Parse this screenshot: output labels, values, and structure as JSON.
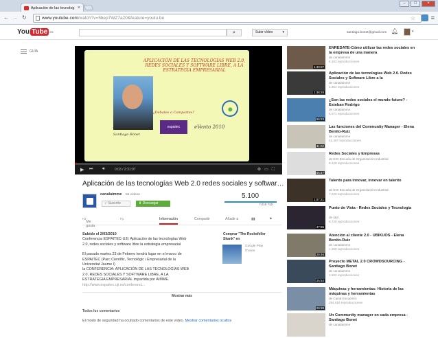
{
  "browser": {
    "tab_title": "Aplicación de las tecnolog",
    "url_main": "www.youtube.com",
    "url_rest": "/watch?v=5bep7WZ7a20&feature=youtu.be"
  },
  "header": {
    "logo_you": "You",
    "logo_tube": "Tube",
    "logo_region": "ES",
    "upload_label": "Subir vídeo",
    "email": "santiago.bonet@gmail.com"
  },
  "guide": {
    "label": "GUÍA"
  },
  "player": {
    "slide_title": "APLICACIÓN DE LAS TECNOLOGÍAS WEB 2.0, REDES SOCIALES Y SOFTWARE LIBRE, A LA ESTRATEGIA EMPRESARIAL",
    "slide_question": "¿Debates o Compartes?",
    "caption": "Santiago Bonet",
    "sponsor": "espaitec",
    "event": "eVento 2010",
    "time": "0:03 / 2:31:07"
  },
  "video": {
    "title": "Aplicación de las tecnologías Web 2.0 redes sociales y softwar…",
    "channel": "canalaimme",
    "channel_videos": "56 vídeos",
    "subscribe": "Suscrito",
    "download": "Descargar",
    "views": "5.100",
    "likes": "16",
    "dislikes": "0"
  },
  "tabs": [
    "Me gusta",
    "Información",
    "Compartir",
    "Añadir a"
  ],
  "description": {
    "uploaded": "Subido el 2/03/2010",
    "lines": [
      "Conferencia ESPAITEC-UJI: Aplicación de las tecnologías Web",
      "2.0, redes sociales y software libre la estrategia empresarial",
      "",
      "El pasado martes 23 de Febrero tendrá lugar en el marco de",
      "ESPAITEC (Parc Científic, Tecnològic i Empresarial de la",
      "Universitat Jaume I)",
      "la CONFERENCIA: APLICACIÓN DE LAS TECNOLOGÍAS WEB",
      "2.0, REDES SOCIALES Y SOFTWARE LIBRE, A LA",
      "ESTRATEGIA EMPRESARIAL impartida por AIMME."
    ],
    "link": "http://www.espaitec.uji.es/conferenci...",
    "buy_label": "Comprar \"The Rockefeller Skank\" en",
    "store": "Google Play",
    "store2": "iTunes",
    "show_more": "Mostrar más"
  },
  "comments": {
    "header": "Todos los comentarios",
    "note": "El modo de seguridad ha ocultado comentarios de este vídeo.",
    "link": "Mostrar comentarios ocultos"
  },
  "related": [
    {
      "title": "ENREDATE-Cómo utilizar las redes sociales en la empresa de una manera",
      "by": "de canalaimme",
      "views": "6.153 reproducciones",
      "dur": "1:40:07",
      "color": "#6d5a4a"
    },
    {
      "title": "Aplicación de las tecnologías Web 2.0. Redes Sociales y Software Libre a la",
      "by": "de canalaimme",
      "views": "2.364 reproducciones",
      "dur": "1:38:28",
      "color": "#3a3a3a"
    },
    {
      "title": "¿Son las redes sociales el mundo futuro? - Esteban Rodrigo",
      "by": "de canalaimme",
      "views": "5.071 reproducciones",
      "dur": "56:23",
      "color": "#4a7fb0"
    },
    {
      "title": "Las funciones del Community Manager - Elena Benito-Ruiz",
      "by": "de canalaimme",
      "views": "41.467 reproducciones",
      "dur": "31:02",
      "color": "#c9c4b8"
    },
    {
      "title": "Redes Sociales y Empresas",
      "by": "de EOI Escuela de Organización Industrial",
      "views": "8.429 reproducciones",
      "dur": "56:47",
      "color": "#ddd"
    },
    {
      "title": "Talento para innovar, innovar en talento",
      "by": "de EOI Escuela de Organización Industrial",
      "views": "7.229 reproducciones",
      "dur": "1:07:21",
      "color": "#3d3228"
    },
    {
      "title": "Punto de Vista - Redes Sociales y Tecnología",
      "by": "de utpl",
      "views": "8.720 reproducciones",
      "dur": "47:55",
      "color": "#2a2530"
    },
    {
      "title": "Atención al cliente 2.0 - UBIKUOS - Elena Benito-Ruiz",
      "by": "de canalaimme",
      "views": "1.260 reproducciones",
      "dur": "28:46",
      "color": "#7f7a6a"
    },
    {
      "title": "Proyecto METAL 2.0 CROWDSOURCING - Santiago Bonet",
      "by": "de canalaimme",
      "views": "1.502 reproducciones",
      "dur": "25:54",
      "color": "#3b4a5a"
    },
    {
      "title": "Máquinas y herramientas: Historia de las máquinas y herramientas",
      "by": "de Canal Encuentro",
      "views": "284.616 reproducciones",
      "dur": "28:38",
      "color": "#7a8fa6"
    },
    {
      "title": "Un Community manager en cada empresa - Santiago Bonet",
      "by": "de canalaimme",
      "views": "",
      "dur": "",
      "color": "#d9d4cc"
    }
  ]
}
